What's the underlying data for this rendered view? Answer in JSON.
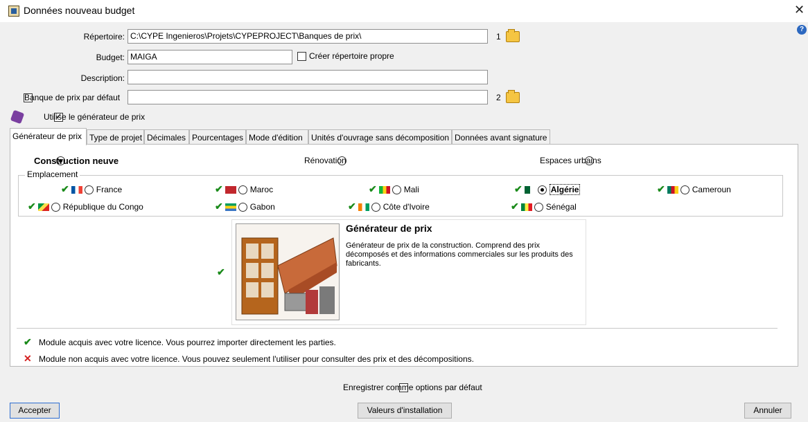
{
  "window": {
    "title": "Données nouveau budget"
  },
  "form": {
    "repertoire_label": "Répertoire:",
    "repertoire_value": "C:\\CYPE Ingenieros\\Projets\\CYPEPROJECT\\Banques de prix\\",
    "repertoire_index": "1",
    "budget_label": "Budget:",
    "budget_value": "MAIGA",
    "creer_repertoire_label": "Créer répertoire propre",
    "description_label": "Description:",
    "description_value": "",
    "banque_defaut_label": "Banque de prix par défaut",
    "banque_value": "",
    "banque_index": "2",
    "utilise_generateur_label": "Utilise le générateur de prix"
  },
  "tabs": [
    {
      "label": "Générateur de prix"
    },
    {
      "label": "Type de projet"
    },
    {
      "label": "Décimales"
    },
    {
      "label": "Pourcentages"
    },
    {
      "label": "Mode d'édition"
    },
    {
      "label": "Unités d'ouvrage sans décomposition"
    },
    {
      "label": "Données avant signature"
    }
  ],
  "generator": {
    "types": [
      {
        "label": "Construction neuve",
        "selected": true
      },
      {
        "label": "Rénovation",
        "selected": false
      },
      {
        "label": "Espaces urbains",
        "selected": false
      }
    ],
    "emplacement_label": "Emplacement",
    "countries": [
      {
        "label": "France",
        "selected": false
      },
      {
        "label": "Maroc",
        "selected": false
      },
      {
        "label": "Mali",
        "selected": false
      },
      {
        "label": "Algérie",
        "selected": true
      },
      {
        "label": "Cameroun",
        "selected": false
      },
      {
        "label": "République du Congo",
        "selected": false
      },
      {
        "label": "Gabon",
        "selected": false
      },
      {
        "label": "Côte d'Ivoire",
        "selected": false
      },
      {
        "label": "Sénégal",
        "selected": false
      }
    ],
    "module": {
      "title": "Générateur de prix",
      "description": "Générateur de prix de la construction. Comprend des prix décomposés et des informations commerciales sur les produits des fabricants."
    },
    "legend_acquired": "Module acquis avec votre licence. Vous pourrez importer directement les parties.",
    "legend_not_acquired": "Module non acquis avec votre licence. Vous pouvez seulement l'utiliser pour consulter des prix et des décompositions."
  },
  "footer": {
    "save_default_label": "Enregistrer comme options par défaut",
    "accept_label": "Accepter",
    "install_values_label": "Valeurs d'installation",
    "cancel_label": "Annuler"
  },
  "colors": {
    "check_green": "#1a8a1a",
    "cross_red": "#d42020",
    "selection_blue": "#2e6dd1"
  }
}
